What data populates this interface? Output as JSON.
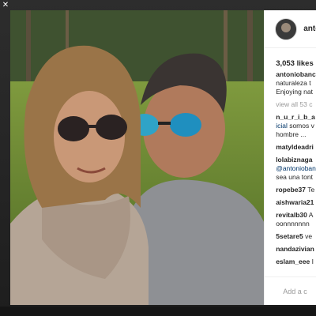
{
  "post": {
    "username": "antonioba",
    "likes": "3,053 likes",
    "caption": {
      "user": "antoniobanc",
      "lines": [
        "naturaleza t",
        "Enjoying nat"
      ]
    },
    "view_all": "view all 53 c",
    "comments": [
      {
        "user": "n_u_r_i_b_a",
        "lines": [
          {
            "text": "icial",
            "style": "mention",
            "rest": " somos v"
          },
          {
            "text": "hombre ...",
            "style": "plain",
            "rest": ""
          }
        ]
      },
      {
        "user": "matyldeadri",
        "lines": []
      },
      {
        "user": "lolabiznaga",
        "lines": [
          {
            "text": "@antoniobanc",
            "style": "mention",
            "rest": ""
          },
          {
            "text": "sea una tont",
            "style": "plain",
            "rest": ""
          }
        ]
      },
      {
        "user": "ropebe37",
        "rest": " Te",
        "lines": []
      },
      {
        "user": "aishwaria21",
        "lines": []
      },
      {
        "user": "revitalb30",
        "rest": " A",
        "lines": [
          {
            "text": "oonnnnnnn",
            "style": "plain",
            "rest": ""
          }
        ]
      },
      {
        "user": "5setare5",
        "rest": " ve",
        "lines": []
      },
      {
        "user": "nandazivian",
        "lines": []
      },
      {
        "user": "eslam_eee",
        "rest": " I",
        "lines": []
      }
    ],
    "add_comment_placeholder": "Add a c",
    "icons": {
      "like": "heart-outline-icon",
      "avatar": "profile-avatar",
      "close": "close-icon"
    }
  }
}
